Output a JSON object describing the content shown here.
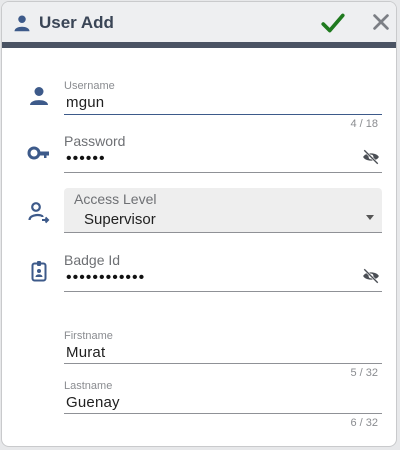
{
  "dialog": {
    "title": "User Add",
    "icons": {
      "title": "person-icon",
      "confirm": "checkmark-icon",
      "close": "close-icon"
    },
    "colors": {
      "header_bar": "#4a5363",
      "accent": "#3d5a8a",
      "confirm": "#1f7a1f"
    }
  },
  "fields": {
    "username": {
      "label": "Username",
      "value": "mgun",
      "counter": "4 / 18",
      "icon": "person-icon"
    },
    "password": {
      "label": "Password",
      "value": "••••••",
      "icon": "key-icon",
      "toggle_icon": "eye-off-icon"
    },
    "access_level": {
      "label": "Access Level",
      "value": "Supervisor",
      "icon": "person-arrow-icon"
    },
    "badge_id": {
      "label": "Badge Id",
      "value": "••••••••••••",
      "icon": "badge-icon",
      "toggle_icon": "eye-off-icon"
    },
    "firstname": {
      "label": "Firstname",
      "value": "Murat",
      "counter": "5 / 32"
    },
    "lastname": {
      "label": "Lastname",
      "value": "Guenay",
      "counter": "6 / 32"
    }
  }
}
